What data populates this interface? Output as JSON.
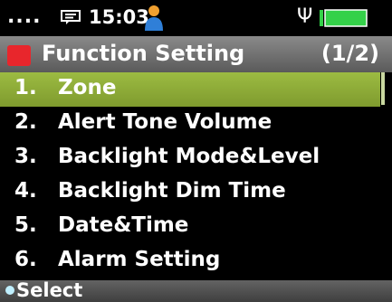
{
  "status_bar": {
    "dots": "....",
    "time": "15:03",
    "usb_symbol": "Ψ",
    "battery_level": 1.0
  },
  "title_bar": {
    "title": "Function Setting",
    "page": "(1/2)"
  },
  "menu": {
    "items": [
      {
        "num": "1.",
        "label": "Zone"
      },
      {
        "num": "2.",
        "label": "Alert Tone Volume"
      },
      {
        "num": "3.",
        "label": "Backlight Mode&Level"
      },
      {
        "num": "4.",
        "label": "Backlight Dim Time"
      },
      {
        "num": "5.",
        "label": "Date&Time"
      },
      {
        "num": "6.",
        "label": "Alarm Setting"
      }
    ],
    "selected_index": 0
  },
  "softkey": {
    "label": "Select"
  },
  "colors": {
    "selection": "#89a536",
    "title_icon": "#e8262c",
    "battery": "#34d149",
    "user_icon": "#f0a030"
  }
}
